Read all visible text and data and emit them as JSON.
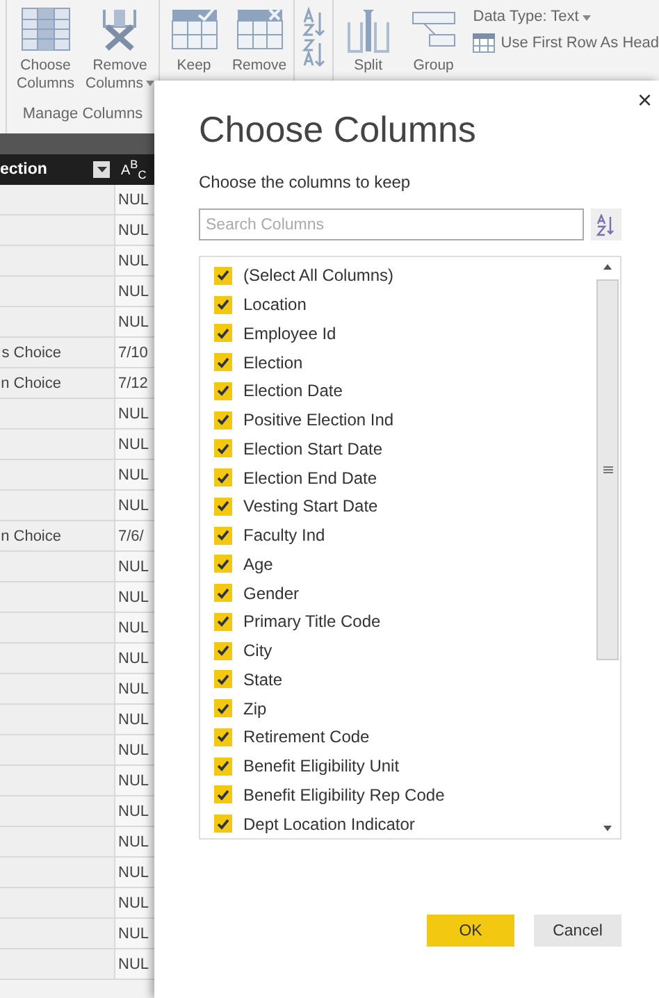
{
  "ribbon": {
    "groups": [
      {
        "kind": "buttons",
        "label": "Manage Columns",
        "buttons": [
          {
            "label": "Choose Columns",
            "dropdown": false
          },
          {
            "label": "Remove Columns",
            "dropdown": true
          }
        ]
      },
      {
        "kind": "buttons",
        "buttons": [
          {
            "label": "Keep"
          },
          {
            "label": "Remove"
          }
        ]
      },
      {
        "kind": "sort"
      },
      {
        "kind": "buttons",
        "buttons": [
          {
            "label": "Split"
          },
          {
            "label": "Group"
          }
        ]
      }
    ],
    "data_type": "Data Type: Text",
    "first_row": "Use First Row As Head"
  },
  "grid": {
    "header": {
      "column_1": "ection",
      "column_2": "A$^{B}$$_{C}$"
    },
    "rows": [
      {
        "column_1": "",
        "column_2": "NUL"
      },
      {
        "column_1": "",
        "column_2": "NUL"
      },
      {
        "column_1": "",
        "column_2": "NUL"
      },
      {
        "column_1": "",
        "column_2": "NUL"
      },
      {
        "column_1": "",
        "column_2": "NUL"
      },
      {
        "column_1": "s Choice",
        "column_2": "7/10"
      },
      {
        "column_1": "n Choice",
        "column_2": "7/12"
      },
      {
        "column_1": "",
        "column_2": "NUL"
      },
      {
        "column_1": "",
        "column_2": "NUL"
      },
      {
        "column_1": "",
        "column_2": "NUL"
      },
      {
        "column_1": "",
        "column_2": "NUL"
      },
      {
        "column_1": "n Choice",
        "column_2": "7/6/"
      },
      {
        "column_1": "",
        "column_2": "NUL"
      },
      {
        "column_1": "",
        "column_2": "NUL"
      },
      {
        "column_1": "",
        "column_2": "NUL"
      },
      {
        "column_1": "",
        "column_2": "NUL"
      },
      {
        "column_1": "",
        "column_2": "NUL"
      },
      {
        "column_1": "",
        "column_2": "NUL"
      },
      {
        "column_1": "",
        "column_2": "NUL"
      },
      {
        "column_1": "",
        "column_2": "NUL"
      },
      {
        "column_1": "",
        "column_2": "NUL"
      },
      {
        "column_1": "",
        "column_2": "NUL"
      },
      {
        "column_1": "",
        "column_2": "NUL"
      },
      {
        "column_1": "",
        "column_2": "NUL"
      },
      {
        "column_1": "",
        "column_2": "NUL"
      },
      {
        "column_1": "",
        "column_2": "NUL"
      }
    ]
  },
  "dialog": {
    "close": "×",
    "title": "Choose Columns",
    "subtitle": "Choose the columns to keep",
    "search": {
      "placeholder": "Search Columns"
    },
    "columns": [
      {
        "label": "(Select All Columns)",
        "checked": true
      },
      {
        "label": "Location",
        "checked": true
      },
      {
        "label": "Employee Id",
        "checked": true
      },
      {
        "label": "Election",
        "checked": true
      },
      {
        "label": "Election Date",
        "checked": true
      },
      {
        "label": "Positive Election Ind",
        "checked": true
      },
      {
        "label": "Election Start Date",
        "checked": true
      },
      {
        "label": "Election End Date",
        "checked": true
      },
      {
        "label": "Vesting Start Date",
        "checked": true
      },
      {
        "label": "Faculty Ind",
        "checked": true
      },
      {
        "label": "Age",
        "checked": true
      },
      {
        "label": "Gender",
        "checked": true
      },
      {
        "label": "Primary Title Code",
        "checked": true
      },
      {
        "label": "City",
        "checked": true
      },
      {
        "label": "State",
        "checked": true
      },
      {
        "label": "Zip",
        "checked": true
      },
      {
        "label": "Retirement Code",
        "checked": true
      },
      {
        "label": "Benefit Eligibility Unit",
        "checked": true
      },
      {
        "label": "Benefit Eligibility Rep Code",
        "checked": true
      },
      {
        "label": "Dept Location Indicator",
        "checked": true
      }
    ],
    "buttons": [
      {
        "label": "OK",
        "kind": "primary"
      },
      {
        "label": "Cancel",
        "kind": "secondary"
      }
    ]
  }
}
